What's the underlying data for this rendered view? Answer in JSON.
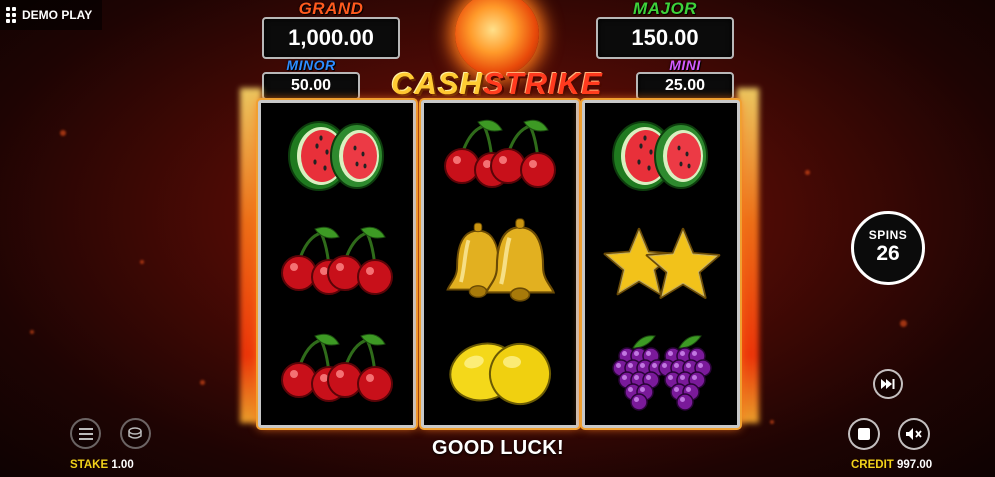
{
  "header": {
    "demo_label": "DEMO PLAY"
  },
  "jackpots": {
    "grand": {
      "label": "GRAND",
      "value": "1,000.00",
      "color": "#ff5a1e"
    },
    "major": {
      "label": "MAJOR",
      "value": "150.00",
      "color": "#3fd13a"
    },
    "minor": {
      "label": "MINOR",
      "value": "50.00",
      "color": "#2e8cff"
    },
    "mini": {
      "label": "MINI",
      "value": "25.00",
      "color": "#d35cff"
    }
  },
  "logo": {
    "word1": "CASH",
    "word2": "STRIKE"
  },
  "reels": [
    [
      "watermelon",
      "cherry",
      "cherry"
    ],
    [
      "cherry",
      "bell",
      "lemon"
    ],
    [
      "watermelon",
      "star",
      "grapes"
    ]
  ],
  "spins": {
    "label": "SPINS",
    "count": "26"
  },
  "status": {
    "message": "GOOD LUCK!"
  },
  "footer": {
    "stake_label": "STAKE",
    "stake_value": "1.00",
    "credit_label": "CREDIT",
    "credit_value": "997.00"
  },
  "icons": {
    "menu": "menu-icon",
    "coins": "coins-icon",
    "fast_forward": "fast-forward-icon",
    "stop": "stop-icon",
    "sound": "mute-icon"
  },
  "colors": {
    "accent_gold": "#f2d21a",
    "flame": "#ff7a1a"
  }
}
